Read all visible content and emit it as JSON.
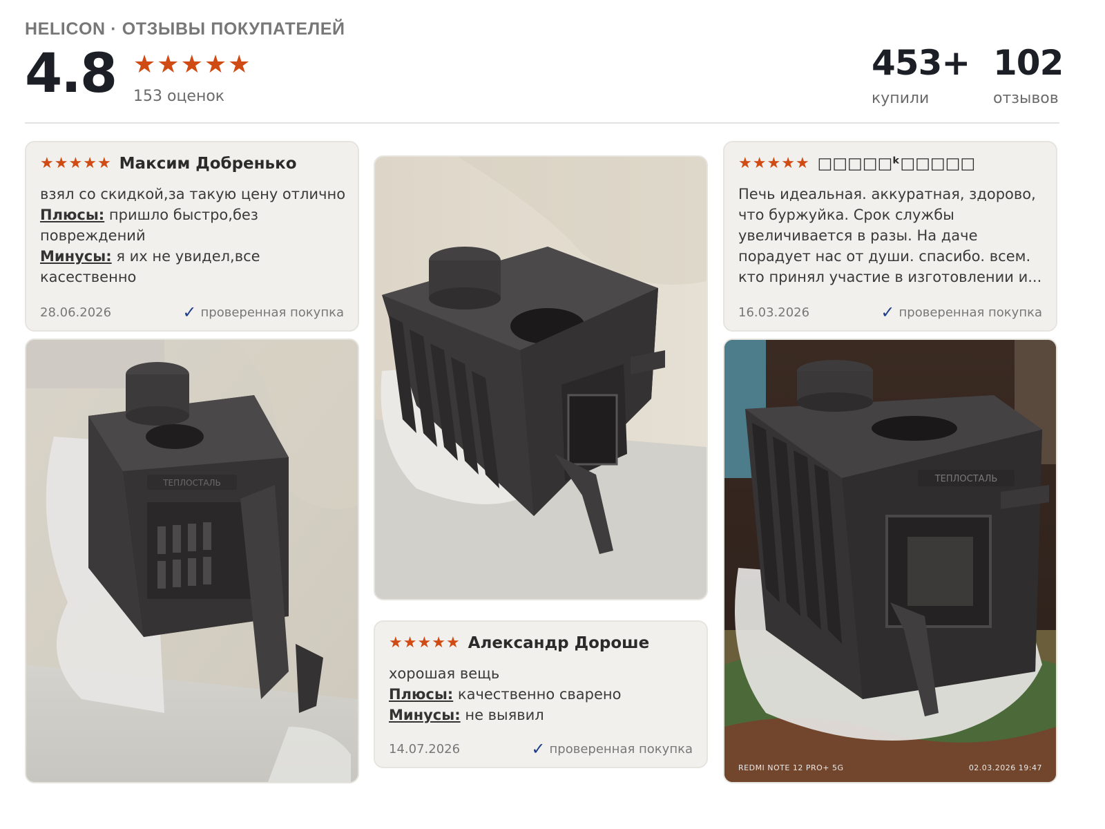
{
  "header": {
    "brand": "HELICON · ОТЗЫВЫ ПОКУПАТЕЛЕЙ",
    "rating": "4.8",
    "stars_rating": 5,
    "ratings_count": "153 оценок",
    "stats": [
      {
        "value": "453+",
        "label": "купили"
      },
      {
        "value": "102",
        "label": "отзывов"
      }
    ]
  },
  "colors": {
    "star": "#d04a13",
    "card_bg": "#f1f0ed",
    "verified_check": "#1f3d8a"
  },
  "reviews": [
    {
      "author": "Максим Добренько",
      "stars": 5,
      "text": "взял со скидкой,за такую цену отлично",
      "pros_label": "Плюсы:",
      "pros": "пришло быстро,без повреждений",
      "cons_label": "Минусы:",
      "cons": "я их не увидел,все касественно",
      "date": "28.06.2026",
      "verified": "проверенная покупка"
    },
    {
      "author": "Александр Дороше",
      "stars": 5,
      "text": "хорошая вещь",
      "pros_label": "Плюсы:",
      "pros": "качественно сварено",
      "cons_label": "Минусы:",
      "cons": "не выявил",
      "date": "14.07.2026",
      "verified": "проверенная покупка"
    },
    {
      "author": "□□□□□ᵏ□□□□□",
      "stars": 5,
      "text": "Печь идеальная. аккуратная, здорово, что буржуйка. Срок службы увеличивается в разы. На даче порадует нас от души. спасибо. всем. кто принял участие в изготовлении и...",
      "date": "16.03.2026",
      "verified": "проверенная покупка"
    }
  ],
  "photos": [
    {
      "alt": "stove-photo-open-door"
    },
    {
      "alt": "stove-photo-top-view"
    },
    {
      "alt": "stove-photo-front",
      "camera_caption": "REDMI NOTE 12 PRO+ 5G",
      "timestamp_caption": "02.03.2026 19:47"
    }
  ],
  "stove_label": "ТЕПЛОСТАЛЬ"
}
